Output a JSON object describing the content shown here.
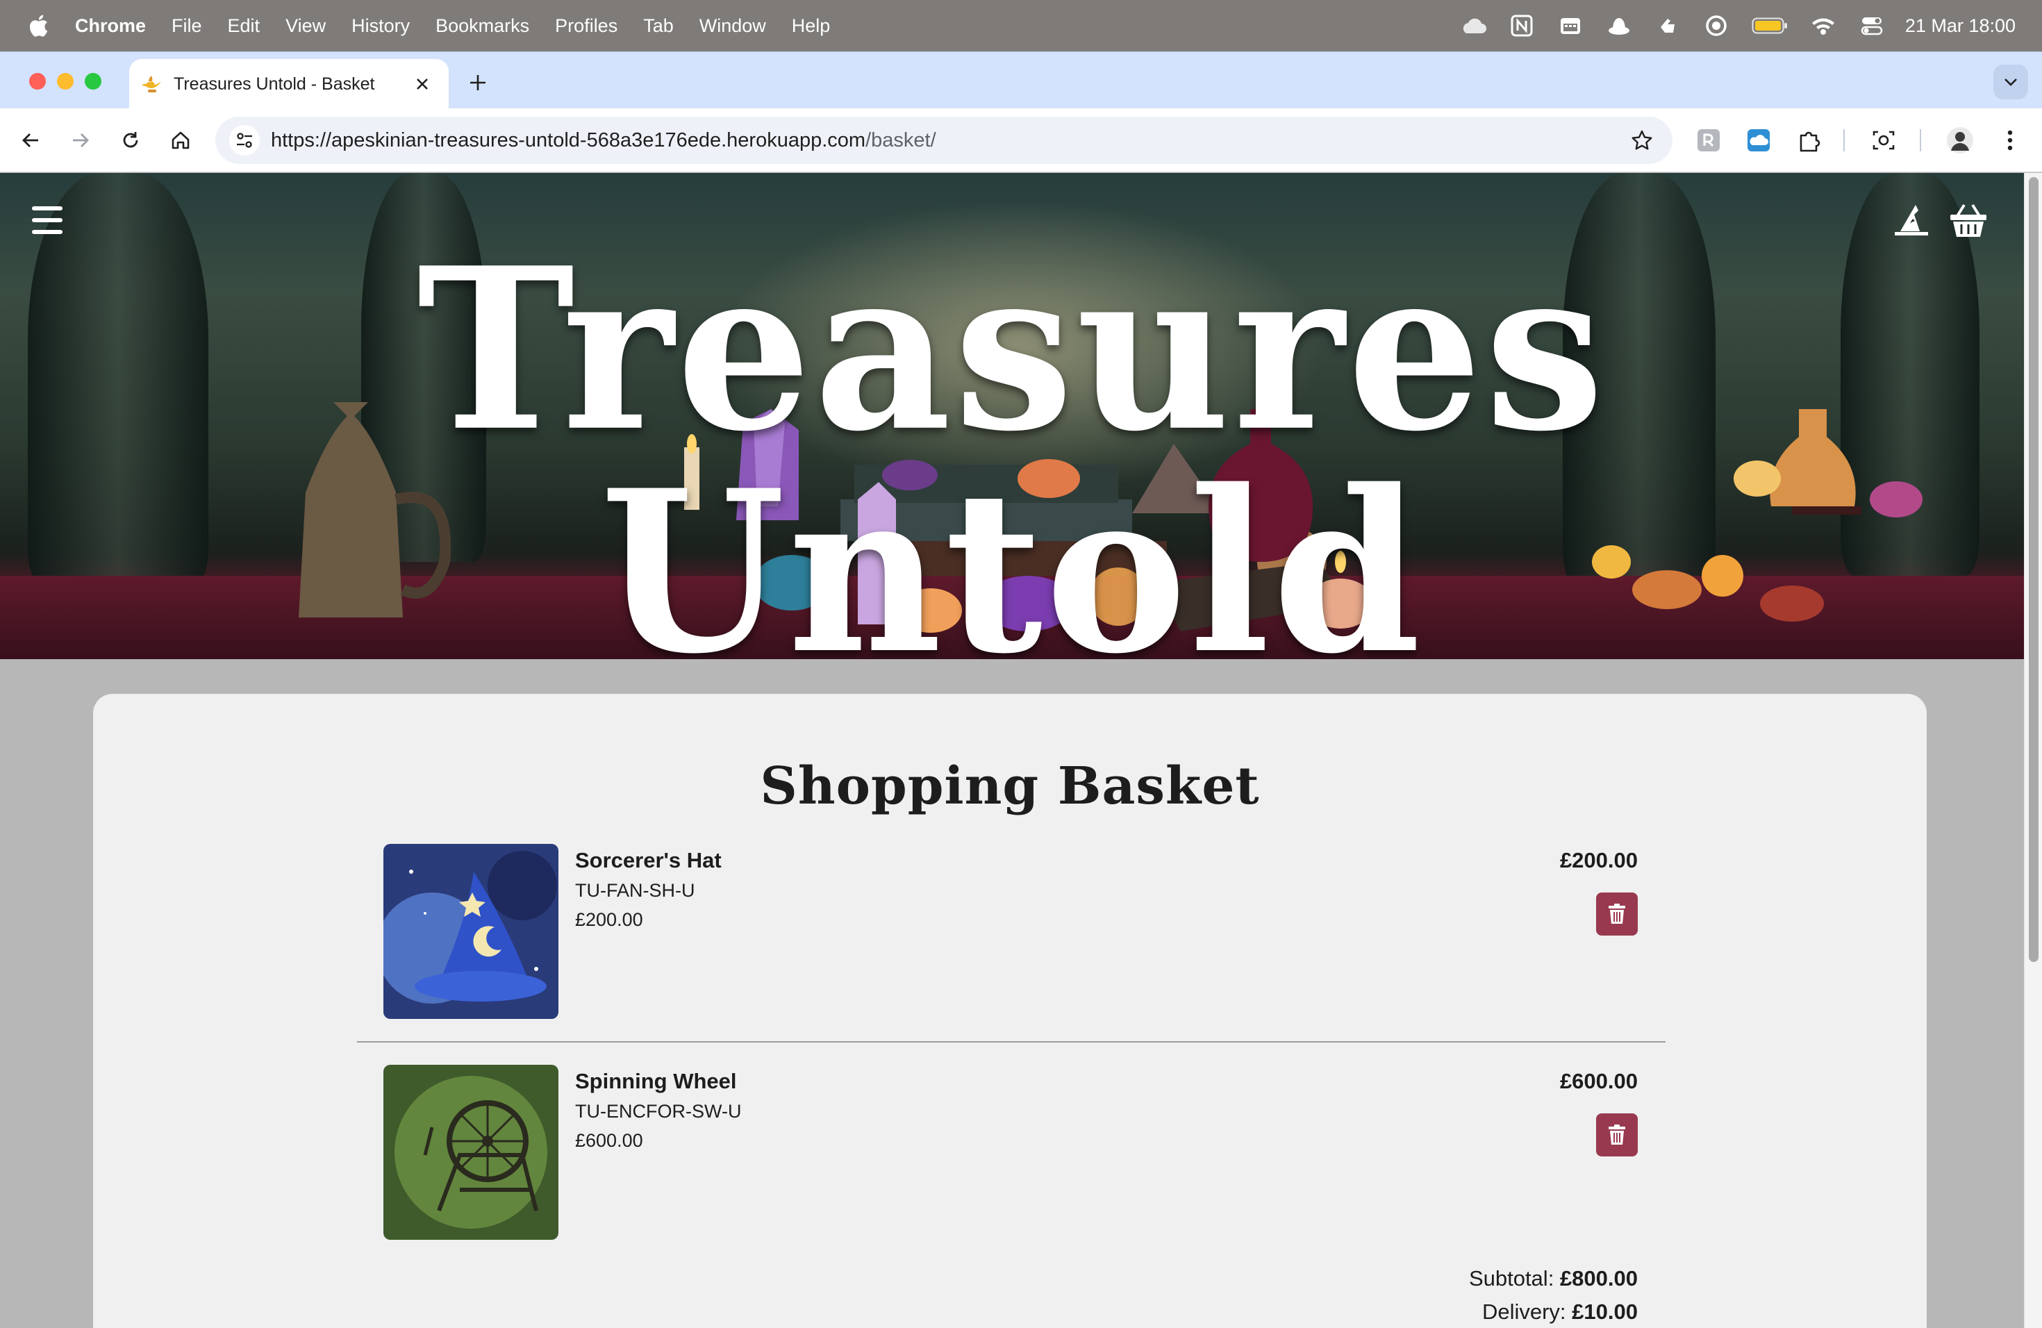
{
  "menubar": {
    "app": "Chrome",
    "items": [
      "File",
      "Edit",
      "View",
      "History",
      "Bookmarks",
      "Profiles",
      "Tab",
      "Window",
      "Help"
    ],
    "clock": "21 Mar  18:00"
  },
  "browser": {
    "tab_title": "Treasures Untold - Basket",
    "url_host": "https://apeskinian-treasures-untold-568a3e176ede.herokuapp.com",
    "url_path": "/basket/"
  },
  "hero": {
    "title": "Treasures Untold"
  },
  "basket": {
    "heading": "Shopping Basket",
    "items": [
      {
        "name": "Sorcerer's Hat",
        "sku": "TU-FAN-SH-U",
        "price": "£200.00",
        "total": "£200.00"
      },
      {
        "name": "Spinning Wheel",
        "sku": "TU-ENCFOR-SW-U",
        "price": "£600.00",
        "total": "£600.00"
      }
    ],
    "subtotal_label": "Subtotal:",
    "subtotal": "£800.00",
    "delivery_label": "Delivery:",
    "delivery": "£10.00"
  },
  "colors": {
    "accent": "#98394f",
    "tabstrip": "#d3e3fd",
    "card": "#f0f0f0"
  }
}
